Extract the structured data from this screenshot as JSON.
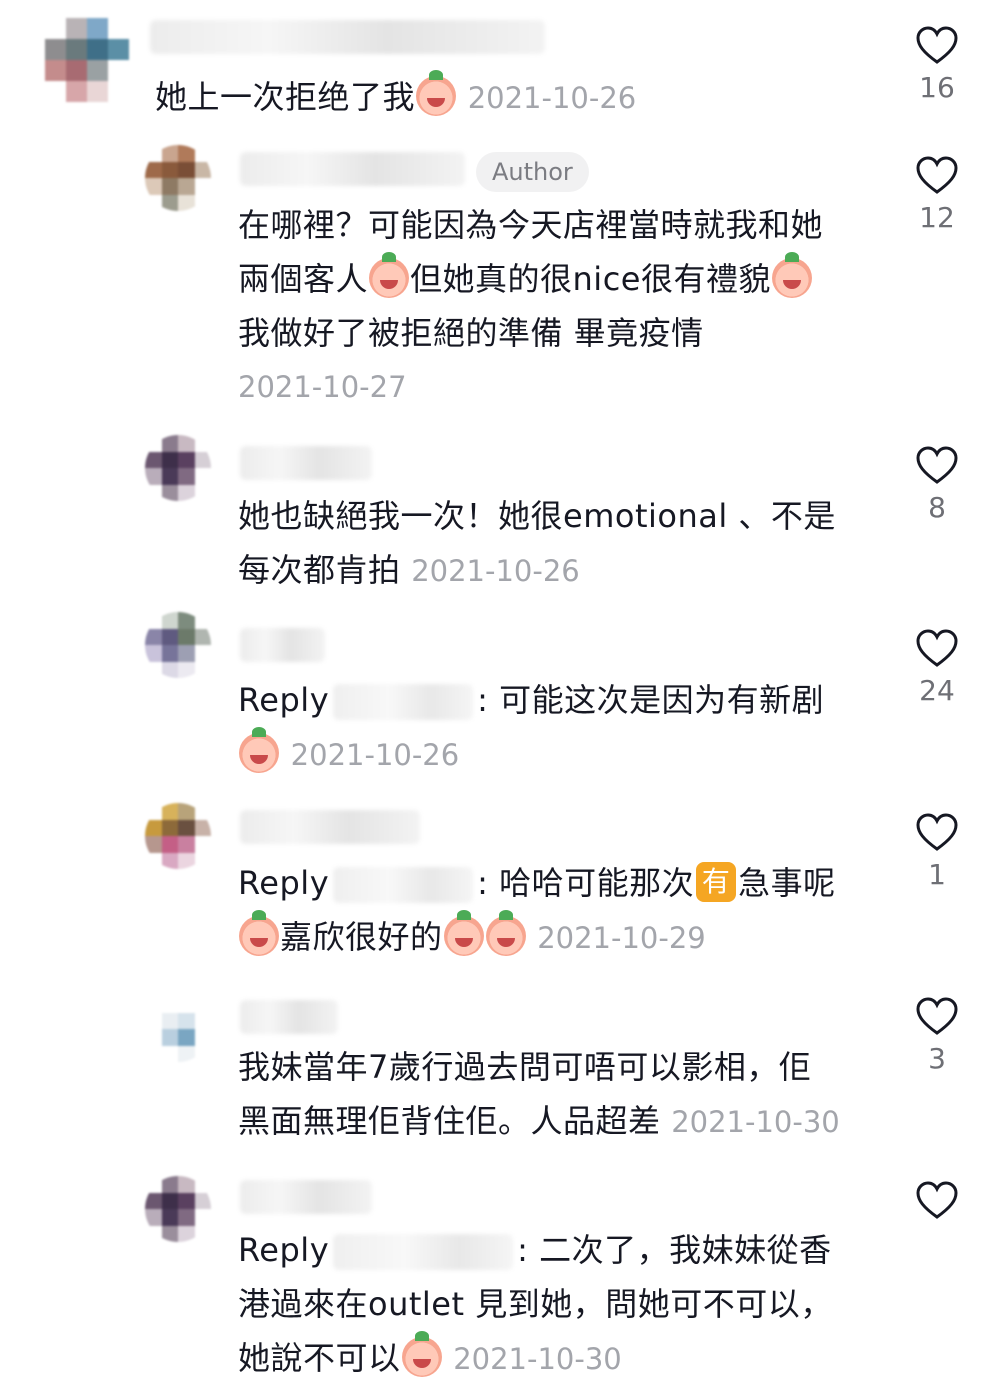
{
  "comments": [
    {
      "text": "她上一次拒绝了我",
      "date": "2021-10-26",
      "likes": "16",
      "avatar_colors": [
        "#ffffff",
        "#b9b3b6",
        "#7fa8c8",
        "#ffffff",
        "#8e8d8f",
        "#6a7a7d",
        "#3f6f88",
        "#5b8fa6",
        "#c48c8c",
        "#a86b72",
        "#9aa1a3",
        "#ffffff",
        "#ffffff",
        "#d7a6a9",
        "#e9d6d6",
        "#ffffff"
      ]
    },
    {
      "author_badge": "Author",
      "text_lines": [
        "在哪裡？可能因為今天店裡當時就我和她",
        "兩個客人",
        "但她真的很nice很有禮貌",
        "我做好了被拒絕的準備 畢竟疫情"
      ],
      "date": "2021-10-27",
      "likes": "12",
      "avatar_colors": [
        "#ffffff",
        "#c9a58f",
        "#b07a5a",
        "#ffffff",
        "#9e6a4a",
        "#8a5a3c",
        "#7a4e36",
        "#c9b7a6",
        "#dcc9b8",
        "#8e7a64",
        "#b9a793",
        "#ffffff",
        "#ffffff",
        "#9c9c8e",
        "#e8e2d8",
        "#ffffff"
      ]
    },
    {
      "text_lines": [
        "她也缺絕我一次！她很emotional 、不是",
        "每次都肯拍"
      ],
      "date": "2021-10-26",
      "likes": "8",
      "avatar_colors": [
        "#ffffff",
        "#8a7b8d",
        "#c8b9c2",
        "#ffffff",
        "#6b5770",
        "#3e2f4a",
        "#5a4060",
        "#d6cfd6",
        "#b9adba",
        "#4a3a58",
        "#806a82",
        "#ffffff",
        "#ffffff",
        "#9a8e9c",
        "#dcd3dc",
        "#ffffff"
      ]
    },
    {
      "reply_label": "Reply",
      "text_line1": ": 可能这次是因为有新剧",
      "date": "2021-10-26",
      "likes": "24",
      "avatar_colors": [
        "#ffffff",
        "#cfd6cf",
        "#7d8c7e",
        "#ffffff",
        "#8a85a8",
        "#5f5a80",
        "#6c7a6a",
        "#b0b6b0",
        "#c9c3db",
        "#77749a",
        "#9d9fb3",
        "#ffffff",
        "#ffffff",
        "#dcd9e6",
        "#eceaf1",
        "#ffffff"
      ]
    },
    {
      "reply_label": "Reply",
      "text_line1_a": ": 哈哈可能那次",
      "you_char": "有",
      "text_line1_b": "急事呢",
      "text_line2": "嘉欣很好的",
      "date": "2021-10-29",
      "likes": "1",
      "avatar_colors": [
        "#ffffff",
        "#d7b25b",
        "#b8a37a",
        "#ffffff",
        "#c79a3e",
        "#8d6a3a",
        "#6a5040",
        "#c8b2a8",
        "#b6978e",
        "#c45f86",
        "#c980a0",
        "#ffffff",
        "#ffffff",
        "#d9a8c2",
        "#ebd5e0",
        "#ffffff"
      ]
    },
    {
      "text_lines": [
        "我妹當年7歲行過去問可唔可以影相，佢",
        "黑面無理佢背住佢。人品超差"
      ],
      "date": "2021-10-30",
      "likes": "3",
      "avatar_colors": [
        "#ffffff",
        "#ffffff",
        "#ffffff",
        "#ffffff",
        "#ffffff",
        "#e9eef2",
        "#d6e3ec",
        "#ffffff",
        "#ffffff",
        "#b9cfdf",
        "#7aa6c2",
        "#ffffff",
        "#ffffff",
        "#ffffff",
        "#eef2f5",
        "#ffffff"
      ]
    },
    {
      "reply_label": "Reply",
      "text_line1": ": 二次了，我妹妹從香",
      "text_line2": "港過來在outlet 見到她，問她可不可以，",
      "text_line3": "她說不可以",
      "date": "2021-10-30",
      "likes": "",
      "avatar_colors": [
        "#ffffff",
        "#8a7b8d",
        "#c8b9c2",
        "#ffffff",
        "#6b5770",
        "#3e2f4a",
        "#5a4060",
        "#d6cfd6",
        "#b9adba",
        "#4a3a58",
        "#806a82",
        "#ffffff",
        "#ffffff",
        "#9a8e9c",
        "#dcd3dc",
        "#ffffff"
      ]
    }
  ]
}
